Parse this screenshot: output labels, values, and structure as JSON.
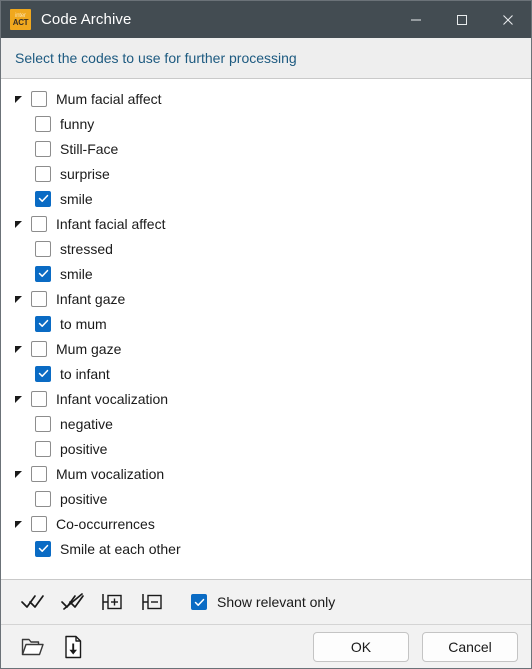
{
  "window": {
    "title": "Code Archive",
    "icon_name": "interact-app-icon",
    "icon_line1": "inter",
    "icon_line2": "ACT",
    "controls": {
      "minimize": "—",
      "maximize": "□",
      "close": "✕"
    }
  },
  "banner": {
    "text": "Select the codes to use for further processing"
  },
  "tree": {
    "nodes": [
      {
        "label": "Mum facial affect",
        "level": 0,
        "checked": false,
        "expanded": true
      },
      {
        "label": "funny",
        "level": 1,
        "checked": false,
        "expanded": null
      },
      {
        "label": "Still-Face",
        "level": 1,
        "checked": false,
        "expanded": null
      },
      {
        "label": "surprise",
        "level": 1,
        "checked": false,
        "expanded": null
      },
      {
        "label": "smile",
        "level": 1,
        "checked": true,
        "expanded": null
      },
      {
        "label": "Infant facial affect",
        "level": 0,
        "checked": false,
        "expanded": true
      },
      {
        "label": "stressed",
        "level": 1,
        "checked": false,
        "expanded": null
      },
      {
        "label": "smile",
        "level": 1,
        "checked": true,
        "expanded": null
      },
      {
        "label": "Infant gaze",
        "level": 0,
        "checked": false,
        "expanded": true
      },
      {
        "label": "to mum",
        "level": 1,
        "checked": true,
        "expanded": null
      },
      {
        "label": "Mum gaze",
        "level": 0,
        "checked": false,
        "expanded": true
      },
      {
        "label": "to infant",
        "level": 1,
        "checked": true,
        "expanded": null
      },
      {
        "label": "Infant vocalization",
        "level": 0,
        "checked": false,
        "expanded": true
      },
      {
        "label": "negative",
        "level": 1,
        "checked": false,
        "expanded": null
      },
      {
        "label": "positive",
        "level": 1,
        "checked": false,
        "expanded": null
      },
      {
        "label": "Mum vocalization",
        "level": 0,
        "checked": false,
        "expanded": true
      },
      {
        "label": "positive",
        "level": 1,
        "checked": false,
        "expanded": null
      },
      {
        "label": "Co-occurrences",
        "level": 0,
        "checked": false,
        "expanded": true
      },
      {
        "label": "Smile at each other",
        "level": 1,
        "checked": true,
        "expanded": null
      }
    ]
  },
  "toolbar": {
    "check_all_icon": "double-check-icon",
    "uncheck_all_icon": "double-check-slashed-icon",
    "expand_all_icon": "expand-all-icon",
    "collapse_all_icon": "collapse-all-icon",
    "show_relevant_label": "Show relevant only",
    "show_relevant_checked": true
  },
  "bottombar": {
    "open_icon": "open-folder-icon",
    "save_icon": "save-document-icon",
    "ok_label": "OK",
    "cancel_label": "Cancel"
  },
  "colors": {
    "titlebar": "#434c52",
    "accent_checkbox": "#0a6bc4",
    "banner_text": "#1d5a80",
    "app_icon": "#f0a81e",
    "chrome": "#f2f2f2"
  }
}
